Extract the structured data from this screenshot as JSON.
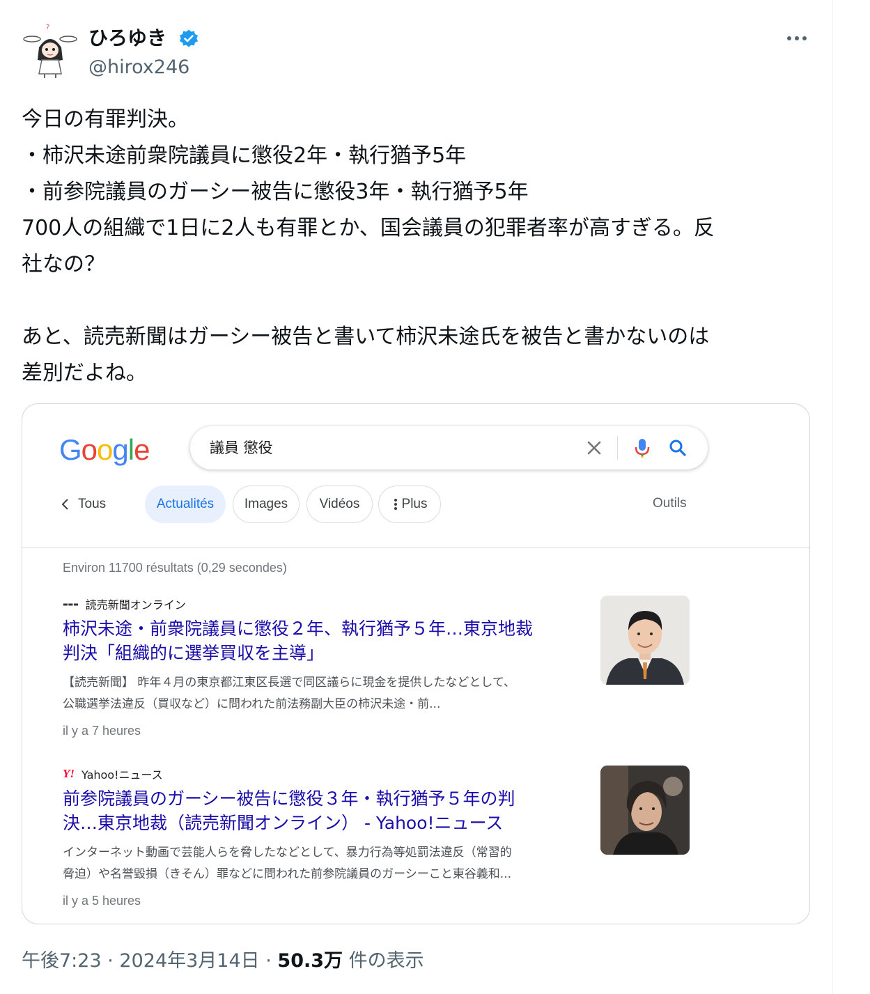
{
  "author": {
    "display_name": "ひろゆき",
    "handle": "@hirox246",
    "verified": true
  },
  "tweet": {
    "lines": [
      "今日の有罪判決。",
      "・柿沢未途前衆院議員に懲役2年・執行猶予5年",
      "・前参院議員のガーシー被告に懲役3年・執行猶予5年",
      "700人の組織で1日に2人も有罪とか、国会議員の犯罪者率が高すぎる。反",
      "社なの？",
      "",
      "あと、読売新聞はガーシー被告と書いて柿沢未途氏を被告と書かないのは",
      "差別だよね。"
    ],
    "time": "午後7:23",
    "date": "2024年3月14日",
    "views_count": "50.3万",
    "views_label": "件の表示"
  },
  "google": {
    "logo_text": "Google",
    "query": "議員 懲役",
    "tabs": [
      {
        "label": "Tous",
        "active": false
      },
      {
        "label": "Actualités",
        "active": true
      },
      {
        "label": "Images",
        "active": false
      },
      {
        "label": "Vidéos",
        "active": false
      },
      {
        "label": "Plus",
        "active": false
      }
    ],
    "tools_label": "Outils",
    "stats": "Environ 11700 résultats (0,29 secondes)",
    "results": [
      {
        "source": "読売新聞オンライン",
        "title_lines": [
          "柿沢未途・前衆院議員に懲役２年、執行猶予５年…東京地裁",
          "判決「組織的に選挙買収を主導」"
        ],
        "snippet_lines": [
          "【読売新聞】 昨年４月の東京都江東区長選で同区議らに現金を提供したなどとして、",
          "公職選挙法違反（買収など）に問われた前法務副大臣の柿沢未途・前..."
        ],
        "time": "il y a 7 heures"
      },
      {
        "source": "Yahoo!ニュース",
        "title_lines": [
          "前参院議員のガーシー被告に懲役３年・執行猶予５年の判",
          "決…東京地裁（読売新聞オンライン） - Yahoo!ニュース"
        ],
        "snippet_lines": [
          "インターネット動画で芸能人らを脅したなどとして、暴力行為等処罰法違反（常習的",
          "脅迫）や名誉毀損（きそん）罪などに問われた前参院議員のガーシーこと東谷義和..."
        ],
        "time": "il y a 5 heures"
      }
    ]
  },
  "colors": {
    "google_blue": "#4285F4",
    "google_red": "#EA4335",
    "google_yellow": "#FBBC05",
    "google_green": "#34A853",
    "link": "#1a0dab",
    "verified": "#1d9bf0"
  }
}
